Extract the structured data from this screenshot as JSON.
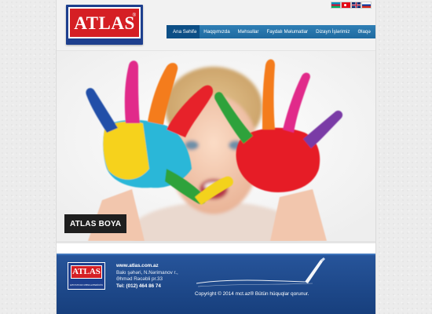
{
  "brand": {
    "logo_text": "ATLAS",
    "registered_mark": "®",
    "colors": {
      "brand_red": "#d51f24",
      "brand_blue": "#1d3f8e",
      "nav_blue": "#2f7fb5",
      "nav_active": "#0d4f86",
      "footer_blue": "#1f4b8f"
    }
  },
  "header": {
    "languages": [
      {
        "code": "az",
        "icon": "azerbaijan-flag-icon"
      },
      {
        "code": "tr",
        "icon": "turkey-flag-icon"
      },
      {
        "code": "en",
        "icon": "uk-flag-icon"
      },
      {
        "code": "ru",
        "icon": "russia-flag-icon"
      }
    ]
  },
  "nav": {
    "items": [
      {
        "label": "Ana Səhifə",
        "active": true
      },
      {
        "label": "Haqqımızda",
        "active": false
      },
      {
        "label": "Məhsullar",
        "active": false
      },
      {
        "label": "Faydalı Məlumatlar",
        "active": false
      },
      {
        "label": "Dizayn İşlərimiz",
        "active": false
      },
      {
        "label": "Əlaqə",
        "active": false
      }
    ]
  },
  "hero": {
    "caption": "ATLAS BOYA"
  },
  "footer": {
    "logo_text": "ATLAS",
    "logo_subtext": "HƏYATINIZ RƏNGLƏNDİRİN",
    "website": "www.atlas.com.az",
    "address_line1": "Bakı şəhəri, N.Nərimanov r.,",
    "address_line2": "Əhməd Rəcəbli pr.33",
    "phone": "Tel: (012) 464 86 74",
    "copyright": "Copyright © 2014 mct.az® Bütün hüquqlar qorunur."
  }
}
